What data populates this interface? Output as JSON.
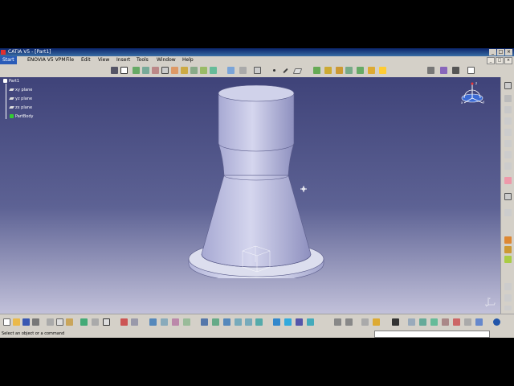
{
  "window": {
    "title": "CATIA V5 - [Part1]",
    "controls": [
      "_",
      "□",
      "×"
    ]
  },
  "menubar": {
    "items": [
      "Start",
      "ENOVIA V5 VPM",
      "File",
      "Edit",
      "View",
      "Insert",
      "Tools",
      "Window",
      "Help"
    ],
    "mdi_controls": [
      "_",
      "□",
      "×"
    ]
  },
  "tree": {
    "root": "Part1",
    "children": [
      "xy plane",
      "yz plane",
      "zx plane",
      "PartBody"
    ]
  },
  "compass": {
    "axis_x": "x",
    "axis_y": "y",
    "axis_z": "z"
  },
  "axis_small": {
    "x": "x",
    "y": "y",
    "z": "z"
  },
  "status": {
    "message": "Select an object or a command",
    "command_value": ""
  },
  "colors": {
    "viewport_top": "#3f4379",
    "viewport_bottom": "#c2c1da",
    "part_fill": "#c9cbe6",
    "title_bar": "#0a246a"
  }
}
